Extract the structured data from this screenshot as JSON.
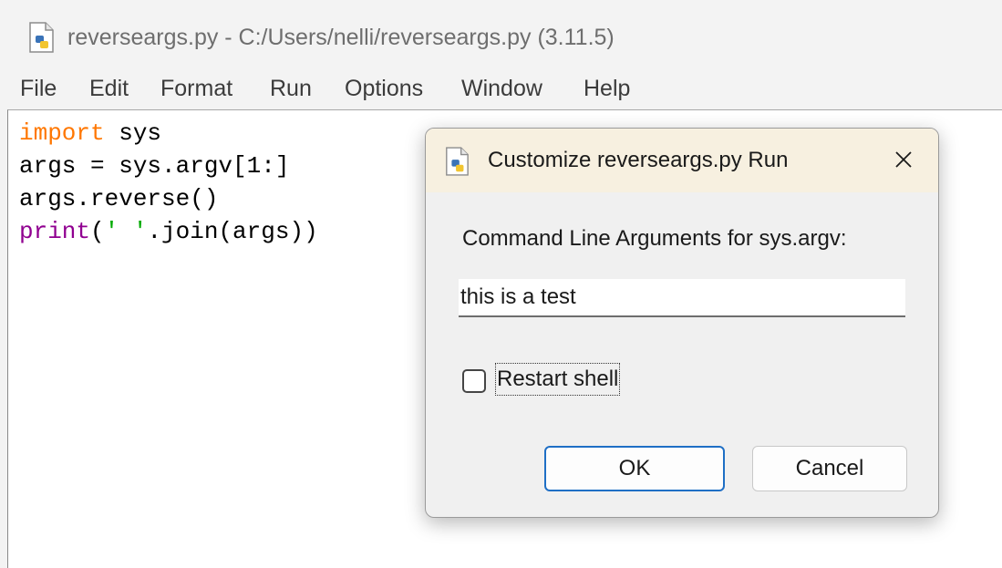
{
  "window": {
    "title": "reverseargs.py - C:/Users/nelli/reverseargs.py (3.11.5)",
    "icon": "python-file-icon"
  },
  "menu": {
    "items": [
      "File",
      "Edit",
      "Format",
      "Run",
      "Options",
      "Window",
      "Help"
    ]
  },
  "editor": {
    "lines": [
      {
        "keyword": "import",
        "rest": " sys"
      },
      {
        "plain": "args = sys.argv[1:]"
      },
      {
        "plain": "args.reverse()"
      },
      {
        "builtin": "print",
        "open": "(",
        "string": "' '",
        "rest": ".join(args))"
      }
    ]
  },
  "dialog": {
    "title": "Customize reverseargs.py Run",
    "close_icon": "close-icon",
    "prompt": "Command Line Arguments for sys.argv:",
    "args_value": "this is a test",
    "restart_label": "Restart shell",
    "restart_checked": false,
    "ok_label": "OK",
    "cancel_label": "Cancel"
  },
  "colors": {
    "keyword": "#ff7700",
    "builtin": "#900090",
    "string": "#00aa00",
    "dialog_title_bg": "#f7f0e0",
    "ok_border": "#1f6fc5"
  }
}
